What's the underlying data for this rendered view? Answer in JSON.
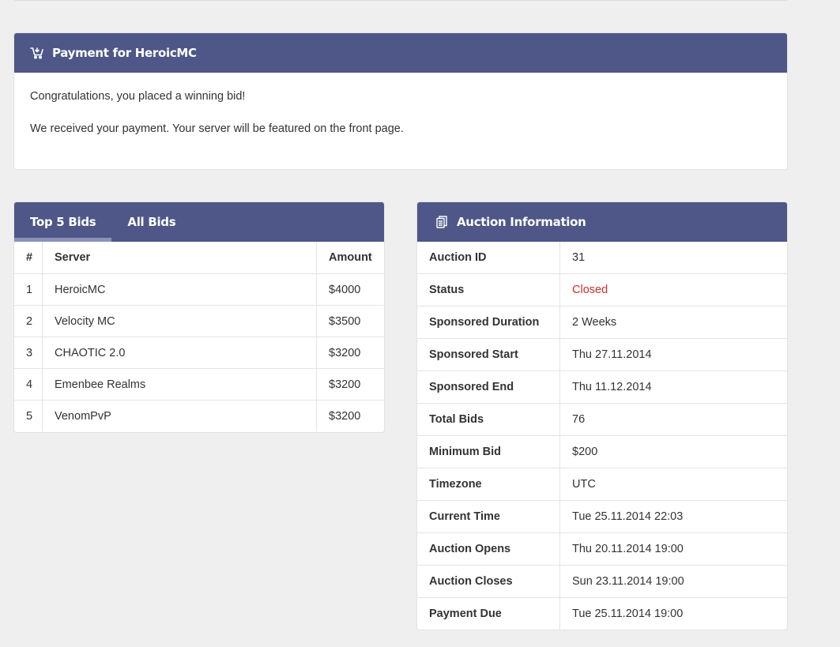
{
  "payment": {
    "title": "Payment for HeroicMC",
    "icon": "cart-icon",
    "message_1": "Congratulations, you placed a winning bid!",
    "message_2": "We received your payment. Your server will be featured on the front page."
  },
  "bids": {
    "tabs": [
      {
        "label": "Top 5 Bids",
        "active": true
      },
      {
        "label": "All Bids",
        "active": false
      }
    ],
    "headers": [
      "#",
      "Server",
      "Amount"
    ],
    "rows": [
      {
        "rank": "1",
        "server": "HeroicMC",
        "amount": "$4000"
      },
      {
        "rank": "2",
        "server": "Velocity MC",
        "amount": "$3500"
      },
      {
        "rank": "3",
        "server": "CHAOTIC 2.0",
        "amount": "$3200"
      },
      {
        "rank": "4",
        "server": "Emenbee Realms",
        "amount": "$3200"
      },
      {
        "rank": "5",
        "server": "VenomPvP",
        "amount": "$3200"
      }
    ]
  },
  "auction": {
    "title": "Auction Information",
    "icon": "document-icon",
    "rows": [
      {
        "key": "Auction ID",
        "value": "31"
      },
      {
        "key": "Status",
        "value": "Closed"
      },
      {
        "key": "Sponsored Duration",
        "value": "2 Weeks"
      },
      {
        "key": "Sponsored Start",
        "value": "Thu  27.11.2014"
      },
      {
        "key": "Sponsored End",
        "value": "Thu  11.12.2014"
      },
      {
        "key": "Total Bids",
        "value": "76"
      },
      {
        "key": "Minimum Bid",
        "value": "$200"
      },
      {
        "key": "Timezone",
        "value": "UTC"
      },
      {
        "key": "Current Time",
        "value": "Tue  25.11.2014 22:03"
      },
      {
        "key": "Auction Opens",
        "value": "Thu  20.11.2014 19:00"
      },
      {
        "key": "Auction Closes",
        "value": "Sun  23.11.2014 19:00"
      },
      {
        "key": "Payment Due",
        "value": "Tue  25.11.2014 19:00"
      }
    ]
  },
  "colors": {
    "header_bg": "#4e5788",
    "tab_indicator": "#8d93b6",
    "status_closed": "#c9302c",
    "page_bg": "#efefef"
  }
}
